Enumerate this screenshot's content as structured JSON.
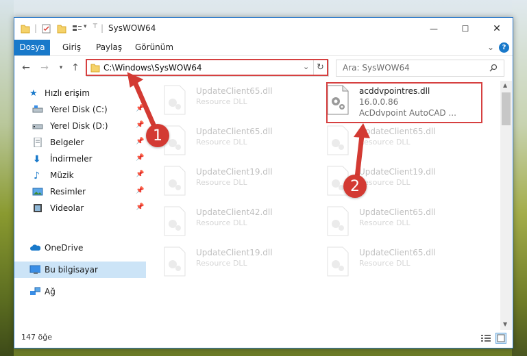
{
  "window": {
    "title": "SysWOW64",
    "minimize_glyph": "—",
    "maximize_glyph": "☐",
    "close_glyph": "✕"
  },
  "ribbon": {
    "tabs": [
      "Dosya",
      "Giriş",
      "Paylaş",
      "Görünüm"
    ],
    "expand_glyph": "⌄",
    "help_glyph": "?"
  },
  "address": {
    "path": "C:\\Windows\\SysWOW64",
    "search_placeholder": "Ara: SysWOW64"
  },
  "nav": {
    "quick_access": "Hızlı erişim",
    "items": [
      {
        "label": "Yerel Disk (C:)",
        "icon": "drive-icon",
        "pinned": true
      },
      {
        "label": "Yerel Disk (D:)",
        "icon": "drive-icon",
        "pinned": true
      },
      {
        "label": "Belgeler",
        "icon": "documents-icon",
        "pinned": true
      },
      {
        "label": "İndirmeler",
        "icon": "downloads-icon",
        "pinned": true
      },
      {
        "label": "Müzik",
        "icon": "music-icon",
        "pinned": true
      },
      {
        "label": "Resimler",
        "icon": "pictures-icon",
        "pinned": true
      },
      {
        "label": "Videolar",
        "icon": "videos-icon",
        "pinned": true
      }
    ],
    "onedrive": "OneDrive",
    "this_pc": "Bu bilgisayar",
    "network": "Ağ"
  },
  "files": [
    {
      "name": "UpdateClient65.dll",
      "type": "Resource DLL",
      "faded": true
    },
    {
      "name": "acddvpointres.dll",
      "type": "16.0.0.86",
      "desc": "AcDdvpoint AutoCAD ...",
      "faded": false
    },
    {
      "name": "UpdateClient65.dll",
      "type": "Resource DLL",
      "faded": true
    },
    {
      "name": "UpdateClient65.dll",
      "type": "Resource DLL",
      "faded": true
    },
    {
      "name": "UpdateClient19.dll",
      "type": "Resource DLL",
      "faded": true
    },
    {
      "name": "UpdateClient19.dll",
      "type": "Resource DLL",
      "faded": true
    },
    {
      "name": "UpdateClient42.dll",
      "type": "Resource DLL",
      "faded": true
    },
    {
      "name": "UpdateClient65.dll",
      "type": "Resource DLL",
      "faded": true
    },
    {
      "name": "UpdateClient19.dll",
      "type": "Resource DLL",
      "faded": true
    },
    {
      "name": "UpdateClient65.dll",
      "type": "Resource DLL",
      "faded": true
    }
  ],
  "status": {
    "count": "147 öğe"
  },
  "callouts": {
    "one": "1",
    "two": "2"
  },
  "colors": {
    "accent": "#1979ca",
    "highlight_red": "#d64040",
    "callout_red": "#d33a33",
    "selection": "#cce4f7"
  }
}
